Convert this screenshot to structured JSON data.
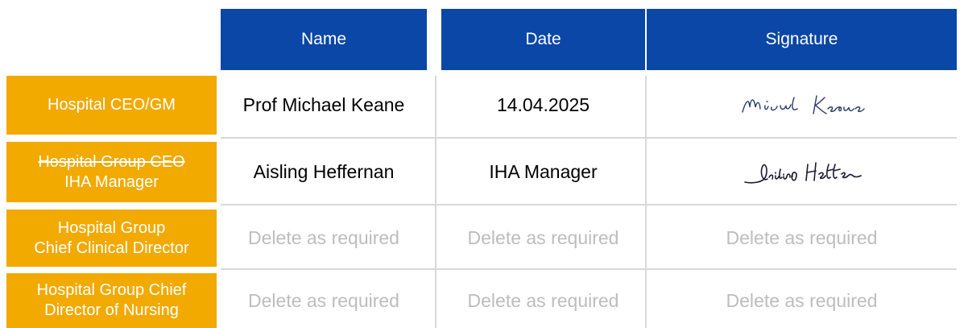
{
  "header": {
    "name_label": "Name",
    "date_label": "Date",
    "signature_label": "Signature"
  },
  "rows": [
    {
      "label_lines": [
        "Hospital CEO/GM"
      ],
      "name": "Prof Michael Keane",
      "date": "14.04.2025",
      "signature": "Micheal Keane"
    },
    {
      "label_struck": "Hospital Group CEO",
      "label_lines": [
        "IHA Manager"
      ],
      "name": "Aisling Heffernan",
      "date": "IHA Manager",
      "signature": "Aisling Heffernan"
    },
    {
      "label_lines": [
        "Hospital Group",
        "Chief Clinical Director"
      ],
      "name": "Delete as required",
      "date": "Delete as required",
      "signature": "Delete as required"
    },
    {
      "label_lines": [
        "Hospital Group Chief",
        "Director of Nursing"
      ],
      "name": "Delete as required",
      "date": "Delete as required",
      "signature": "Delete as required"
    }
  ],
  "colors": {
    "header_bg": "#0a47a6",
    "label_bg": "#f2a900",
    "placeholder_text": "#bdbdbd",
    "grid": "#d9d9d9"
  }
}
